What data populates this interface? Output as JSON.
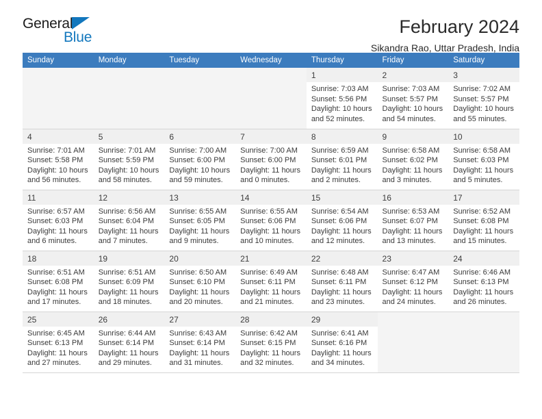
{
  "brand": {
    "name_part1": "General",
    "name_part2": "Blue",
    "triangle_icon": "triangle-icon",
    "accent_color": "#1277bd"
  },
  "header": {
    "title": "February 2024",
    "location": "Sikandra Rao, Uttar Pradesh, India"
  },
  "calendar": {
    "header_bg": "#3c7cbe",
    "weekdays": [
      "Sunday",
      "Monday",
      "Tuesday",
      "Wednesday",
      "Thursday",
      "Friday",
      "Saturday"
    ],
    "labels": {
      "sunrise": "Sunrise:",
      "sunset": "Sunset:",
      "daylight": "Daylight:"
    },
    "weeks": [
      [
        {
          "day": "",
          "sunrise": "",
          "sunset": "",
          "daylight_line1": "",
          "daylight_line2": ""
        },
        {
          "day": "",
          "sunrise": "",
          "sunset": "",
          "daylight_line1": "",
          "daylight_line2": ""
        },
        {
          "day": "",
          "sunrise": "",
          "sunset": "",
          "daylight_line1": "",
          "daylight_line2": ""
        },
        {
          "day": "",
          "sunrise": "",
          "sunset": "",
          "daylight_line1": "",
          "daylight_line2": ""
        },
        {
          "day": "1",
          "sunrise": "Sunrise: 7:03 AM",
          "sunset": "Sunset: 5:56 PM",
          "daylight_line1": "Daylight: 10 hours",
          "daylight_line2": "and 52 minutes."
        },
        {
          "day": "2",
          "sunrise": "Sunrise: 7:03 AM",
          "sunset": "Sunset: 5:57 PM",
          "daylight_line1": "Daylight: 10 hours",
          "daylight_line2": "and 54 minutes."
        },
        {
          "day": "3",
          "sunrise": "Sunrise: 7:02 AM",
          "sunset": "Sunset: 5:57 PM",
          "daylight_line1": "Daylight: 10 hours",
          "daylight_line2": "and 55 minutes."
        }
      ],
      [
        {
          "day": "4",
          "sunrise": "Sunrise: 7:01 AM",
          "sunset": "Sunset: 5:58 PM",
          "daylight_line1": "Daylight: 10 hours",
          "daylight_line2": "and 56 minutes."
        },
        {
          "day": "5",
          "sunrise": "Sunrise: 7:01 AM",
          "sunset": "Sunset: 5:59 PM",
          "daylight_line1": "Daylight: 10 hours",
          "daylight_line2": "and 58 minutes."
        },
        {
          "day": "6",
          "sunrise": "Sunrise: 7:00 AM",
          "sunset": "Sunset: 6:00 PM",
          "daylight_line1": "Daylight: 10 hours",
          "daylight_line2": "and 59 minutes."
        },
        {
          "day": "7",
          "sunrise": "Sunrise: 7:00 AM",
          "sunset": "Sunset: 6:00 PM",
          "daylight_line1": "Daylight: 11 hours",
          "daylight_line2": "and 0 minutes."
        },
        {
          "day": "8",
          "sunrise": "Sunrise: 6:59 AM",
          "sunset": "Sunset: 6:01 PM",
          "daylight_line1": "Daylight: 11 hours",
          "daylight_line2": "and 2 minutes."
        },
        {
          "day": "9",
          "sunrise": "Sunrise: 6:58 AM",
          "sunset": "Sunset: 6:02 PM",
          "daylight_line1": "Daylight: 11 hours",
          "daylight_line2": "and 3 minutes."
        },
        {
          "day": "10",
          "sunrise": "Sunrise: 6:58 AM",
          "sunset": "Sunset: 6:03 PM",
          "daylight_line1": "Daylight: 11 hours",
          "daylight_line2": "and 5 minutes."
        }
      ],
      [
        {
          "day": "11",
          "sunrise": "Sunrise: 6:57 AM",
          "sunset": "Sunset: 6:03 PM",
          "daylight_line1": "Daylight: 11 hours",
          "daylight_line2": "and 6 minutes."
        },
        {
          "day": "12",
          "sunrise": "Sunrise: 6:56 AM",
          "sunset": "Sunset: 6:04 PM",
          "daylight_line1": "Daylight: 11 hours",
          "daylight_line2": "and 7 minutes."
        },
        {
          "day": "13",
          "sunrise": "Sunrise: 6:55 AM",
          "sunset": "Sunset: 6:05 PM",
          "daylight_line1": "Daylight: 11 hours",
          "daylight_line2": "and 9 minutes."
        },
        {
          "day": "14",
          "sunrise": "Sunrise: 6:55 AM",
          "sunset": "Sunset: 6:06 PM",
          "daylight_line1": "Daylight: 11 hours",
          "daylight_line2": "and 10 minutes."
        },
        {
          "day": "15",
          "sunrise": "Sunrise: 6:54 AM",
          "sunset": "Sunset: 6:06 PM",
          "daylight_line1": "Daylight: 11 hours",
          "daylight_line2": "and 12 minutes."
        },
        {
          "day": "16",
          "sunrise": "Sunrise: 6:53 AM",
          "sunset": "Sunset: 6:07 PM",
          "daylight_line1": "Daylight: 11 hours",
          "daylight_line2": "and 13 minutes."
        },
        {
          "day": "17",
          "sunrise": "Sunrise: 6:52 AM",
          "sunset": "Sunset: 6:08 PM",
          "daylight_line1": "Daylight: 11 hours",
          "daylight_line2": "and 15 minutes."
        }
      ],
      [
        {
          "day": "18",
          "sunrise": "Sunrise: 6:51 AM",
          "sunset": "Sunset: 6:08 PM",
          "daylight_line1": "Daylight: 11 hours",
          "daylight_line2": "and 17 minutes."
        },
        {
          "day": "19",
          "sunrise": "Sunrise: 6:51 AM",
          "sunset": "Sunset: 6:09 PM",
          "daylight_line1": "Daylight: 11 hours",
          "daylight_line2": "and 18 minutes."
        },
        {
          "day": "20",
          "sunrise": "Sunrise: 6:50 AM",
          "sunset": "Sunset: 6:10 PM",
          "daylight_line1": "Daylight: 11 hours",
          "daylight_line2": "and 20 minutes."
        },
        {
          "day": "21",
          "sunrise": "Sunrise: 6:49 AM",
          "sunset": "Sunset: 6:11 PM",
          "daylight_line1": "Daylight: 11 hours",
          "daylight_line2": "and 21 minutes."
        },
        {
          "day": "22",
          "sunrise": "Sunrise: 6:48 AM",
          "sunset": "Sunset: 6:11 PM",
          "daylight_line1": "Daylight: 11 hours",
          "daylight_line2": "and 23 minutes."
        },
        {
          "day": "23",
          "sunrise": "Sunrise: 6:47 AM",
          "sunset": "Sunset: 6:12 PM",
          "daylight_line1": "Daylight: 11 hours",
          "daylight_line2": "and 24 minutes."
        },
        {
          "day": "24",
          "sunrise": "Sunrise: 6:46 AM",
          "sunset": "Sunset: 6:13 PM",
          "daylight_line1": "Daylight: 11 hours",
          "daylight_line2": "and 26 minutes."
        }
      ],
      [
        {
          "day": "25",
          "sunrise": "Sunrise: 6:45 AM",
          "sunset": "Sunset: 6:13 PM",
          "daylight_line1": "Daylight: 11 hours",
          "daylight_line2": "and 27 minutes."
        },
        {
          "day": "26",
          "sunrise": "Sunrise: 6:44 AM",
          "sunset": "Sunset: 6:14 PM",
          "daylight_line1": "Daylight: 11 hours",
          "daylight_line2": "and 29 minutes."
        },
        {
          "day": "27",
          "sunrise": "Sunrise: 6:43 AM",
          "sunset": "Sunset: 6:14 PM",
          "daylight_line1": "Daylight: 11 hours",
          "daylight_line2": "and 31 minutes."
        },
        {
          "day": "28",
          "sunrise": "Sunrise: 6:42 AM",
          "sunset": "Sunset: 6:15 PM",
          "daylight_line1": "Daylight: 11 hours",
          "daylight_line2": "and 32 minutes."
        },
        {
          "day": "29",
          "sunrise": "Sunrise: 6:41 AM",
          "sunset": "Sunset: 6:16 PM",
          "daylight_line1": "Daylight: 11 hours",
          "daylight_line2": "and 34 minutes."
        },
        {
          "day": "",
          "sunrise": "",
          "sunset": "",
          "daylight_line1": "",
          "daylight_line2": ""
        },
        {
          "day": "",
          "sunrise": "",
          "sunset": "",
          "daylight_line1": "",
          "daylight_line2": ""
        }
      ]
    ]
  }
}
